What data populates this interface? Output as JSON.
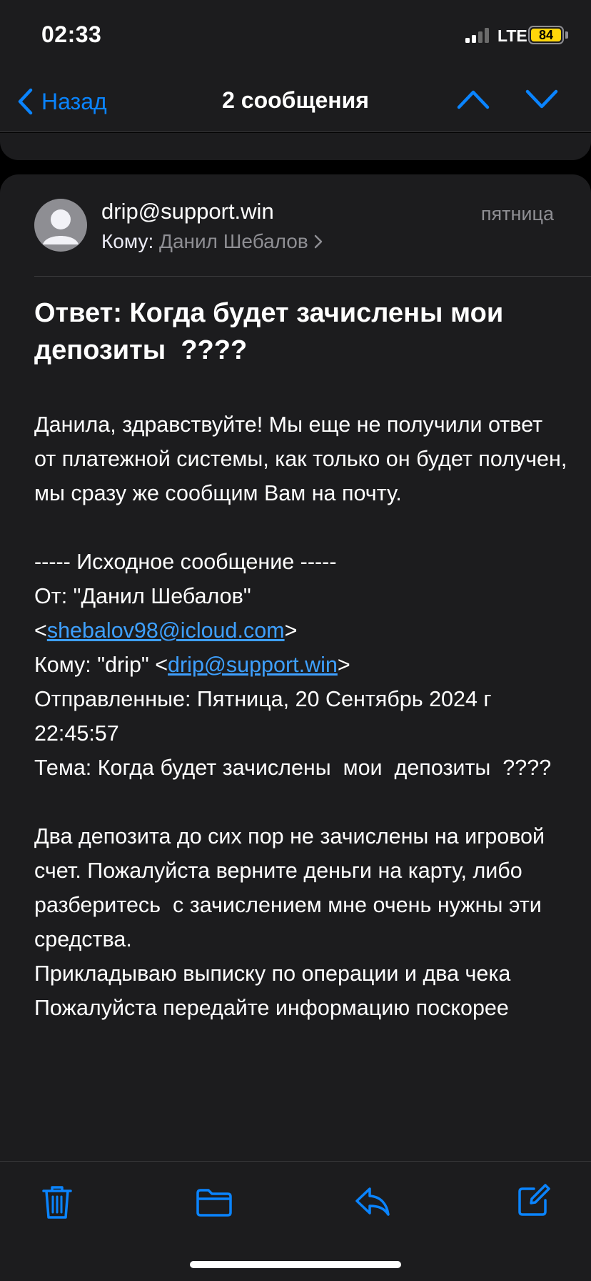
{
  "status_bar": {
    "time": "02:33",
    "network": "LTE",
    "battery_percent": "84",
    "battery_color": "#ffd60a"
  },
  "nav": {
    "back_label": "Назад",
    "title": "2 сообщения",
    "accent_color": "#0a84ff"
  },
  "message": {
    "sender": "drip@support.win",
    "date": "пятница",
    "to_prefix": "Кому:",
    "to_name": "Данил Шебалов",
    "subject": "Ответ: Когда будет зачислены мои  депозиты  ????",
    "reply_paragraph": "Данила, здравствуйте! Мы еще не получили ответ от платежной системы, как только он будет получен, мы сразу же сообщим Вам на почту.",
    "orig_header": "----- Исходное сообщение -----",
    "orig_from_prefix": "От: \"Данил Шебалов\"",
    "orig_from_lt": "<",
    "orig_from_email": "shebalov98@icloud.com",
    "orig_from_gt": ">",
    "orig_to_prefix": "Кому: \"drip\" <",
    "orig_to_email": "drip@support.win",
    "orig_to_gt": ">",
    "orig_sent": "Отправленные: Пятница, 20 Сентябрь 2024 г 22:45:57",
    "orig_subject": "Тема: Когда будет зачислены  мои  депозиты  ????",
    "orig_body_1": "Два депозита до сих пор не зачислены на игровой счет. Пожалуйста верните деньги на карту, либо разберитесь  с зачислением мне очень нужны эти средства.",
    "orig_body_2": "Прикладываю выписку по операции и два чека",
    "orig_body_3": "Пожалуйста передайте информацию поскорее"
  },
  "toolbar": {
    "items": [
      "trash-icon",
      "folder-icon",
      "reply-icon",
      "compose-icon"
    ]
  }
}
